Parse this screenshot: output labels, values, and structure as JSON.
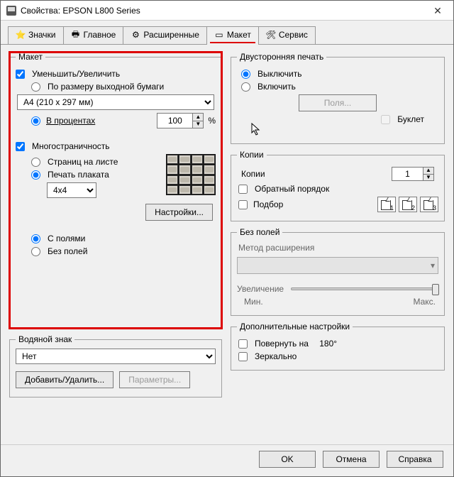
{
  "window": {
    "title": "Свойства: EPSON L800 Series"
  },
  "tabs": {
    "icons": "Значки",
    "main": "Главное",
    "advanced": "Расширенные",
    "layout": "Макет",
    "service": "Сервис"
  },
  "layout_group": {
    "legend": "Макет",
    "reduce_enlarge": "Уменьшить/Увеличить",
    "by_output_paper": "По размеру выходной бумаги",
    "paper_size": "A4 (210 x 297 мм)",
    "percent_label": "В процентах",
    "percent_value": "100",
    "percent_unit": "%",
    "multipage": "Многостраничность",
    "pages_per_sheet": "Страниц на листе",
    "poster_print": "Печать плаката",
    "poster_size": "4x4",
    "settings_btn": "Настройки...",
    "with_margins": "С полями",
    "no_margins": "Без полей"
  },
  "watermark": {
    "legend": "Водяной знак",
    "value": "Нет",
    "add_remove": "Добавить/Удалить...",
    "params": "Параметры..."
  },
  "duplex": {
    "legend": "Двусторонняя печать",
    "off": "Выключить",
    "on": "Включить",
    "margins_btn": "Поля...",
    "booklet": "Буклет"
  },
  "copies": {
    "legend": "Копии",
    "label": "Копии",
    "value": "1",
    "reverse": "Обратный порядок",
    "collate": "Подбор"
  },
  "borderless": {
    "legend": "Без полей",
    "method": "Метод расширения",
    "enlarge": "Увеличение",
    "min": "Мин.",
    "max": "Макс."
  },
  "additional": {
    "legend": "Дополнительные настройки",
    "rotate": "Повернуть на",
    "rotate_deg": "180°",
    "mirror": "Зеркально"
  },
  "footer": {
    "ok": "OK",
    "cancel": "Отмена",
    "help": "Справка"
  }
}
